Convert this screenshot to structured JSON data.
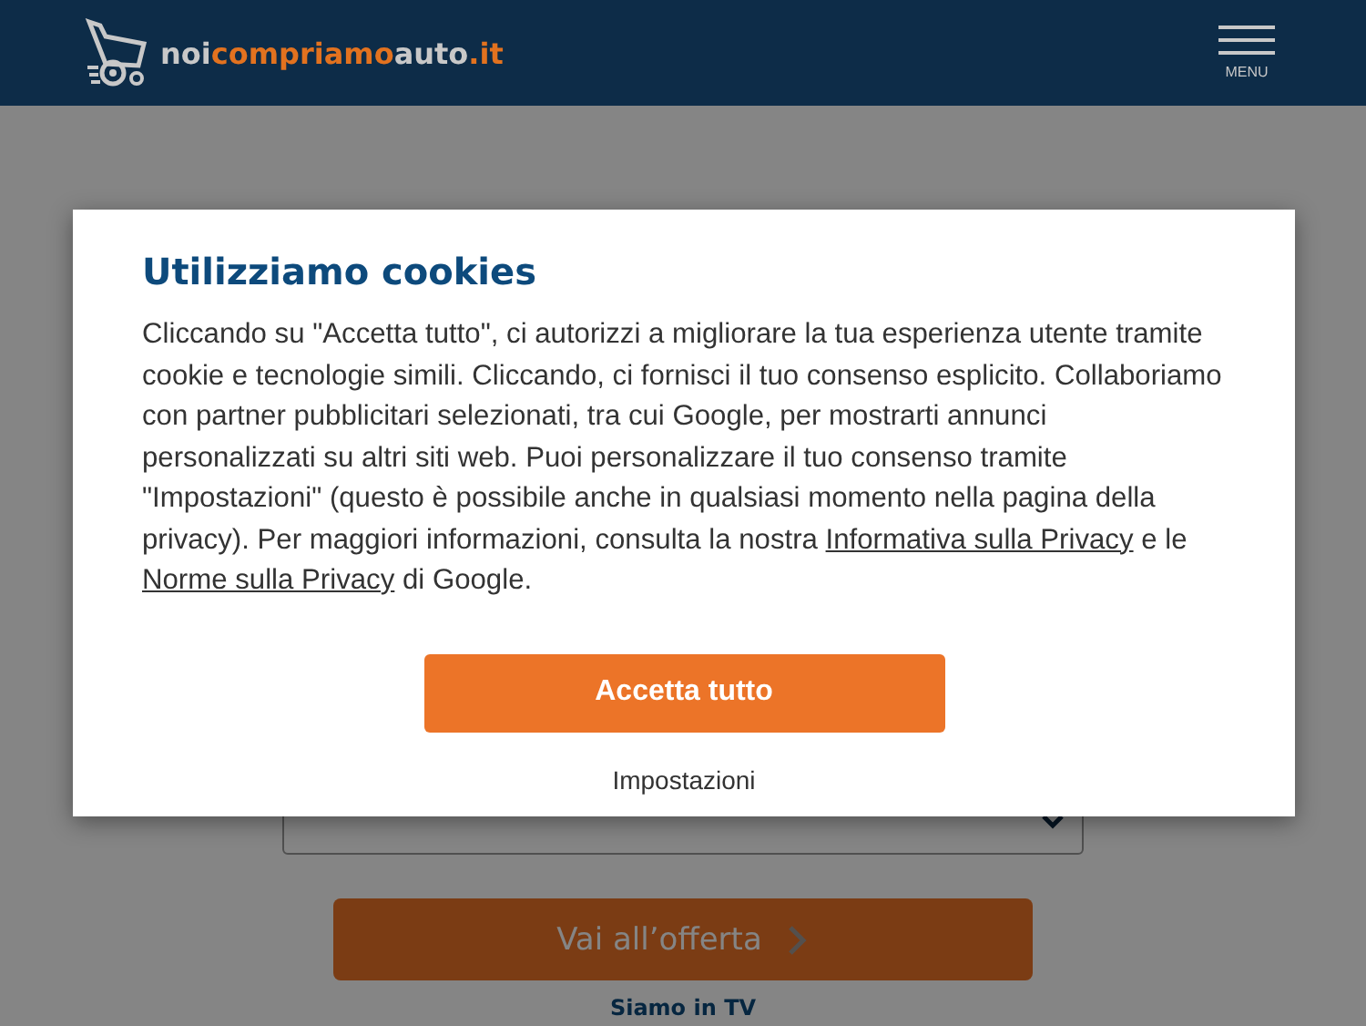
{
  "header": {
    "logo": [
      {
        "text": "noi",
        "color": "#c8c8c8"
      },
      {
        "text": "compriamo",
        "color": "#e2721f"
      },
      {
        "text": "auto",
        "color": "#c8c8c8"
      },
      {
        "text": ".it",
        "color": "#e2721f"
      }
    ],
    "menu_label": "MENU"
  },
  "page": {
    "offer_button": "Vai all’offerta",
    "tv_link": "Siamo in TV"
  },
  "cookie_dialog": {
    "title": "Utilizziamo cookies",
    "body": [
      {
        "kind": "text",
        "text": "Cliccando su \"Accetta tutto\", ci autorizzi a migliorare la tua esperienza utente tramite cookie e tecnologie simili. Cliccando, ci fornisci il tuo consenso esplicito. Collaboriamo con partner pubblicitari selezionati, tra cui Google, per mostrarti annunci personalizzati su altri siti web. Puoi personalizzare il tuo consenso tramite \"Impostazioni\" (questo è possibile anche in qualsiasi momento nella pagina della privacy). Per maggiori informazioni, consulta la nostra "
      },
      {
        "kind": "link",
        "text": "Informativa sulla Privacy"
      },
      {
        "kind": "text",
        "text": " e le "
      },
      {
        "kind": "link",
        "text": "Norme sulla Privacy"
      },
      {
        "kind": "text",
        "text": " di Google."
      }
    ],
    "accept_button": "Accetta tutto",
    "settings_link": "Impostazioni"
  }
}
